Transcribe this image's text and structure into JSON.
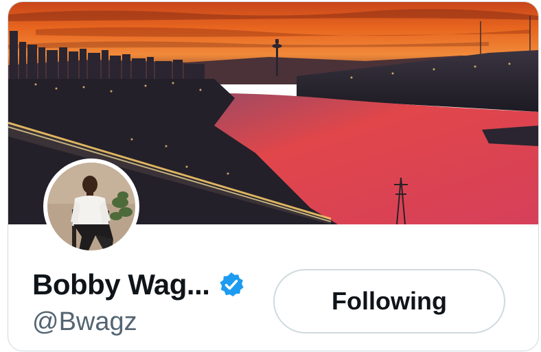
{
  "profile": {
    "display_name": "Bobby Wag...",
    "handle": "@Bwagz",
    "verified": true,
    "verified_icon": "verified-badge-icon",
    "follow_button_label": "Following"
  },
  "colors": {
    "name": "#0f1419",
    "handle": "#536471",
    "verified_blue": "#1d9bf0",
    "button_border": "#cfd9de"
  }
}
